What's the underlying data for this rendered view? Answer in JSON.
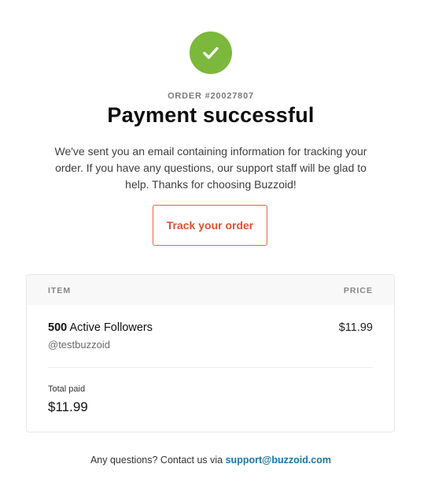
{
  "status": {
    "icon": "check-icon",
    "color": "#7cb83b"
  },
  "order": {
    "number": "ORDER #20027807",
    "title": "Payment successful",
    "message": "We've sent you an email containing information for tracking your order. If you have any questions, our support staff will be glad to help. Thanks for choosing Buzzoid!"
  },
  "actions": {
    "track_label": "Track your order",
    "accent_color": "#e4644a"
  },
  "table": {
    "item_header": "ITEM",
    "price_header": "PRICE",
    "items": [
      {
        "quantity": "500",
        "product": "Active Followers",
        "username": "@testbuzzoid",
        "price": "$11.99"
      }
    ],
    "total_label": "Total paid",
    "total_value": "$11.99"
  },
  "footer": {
    "text": "Any questions? Contact us via",
    "email": "support@buzzoid.com",
    "link_color": "#1c75a8"
  }
}
